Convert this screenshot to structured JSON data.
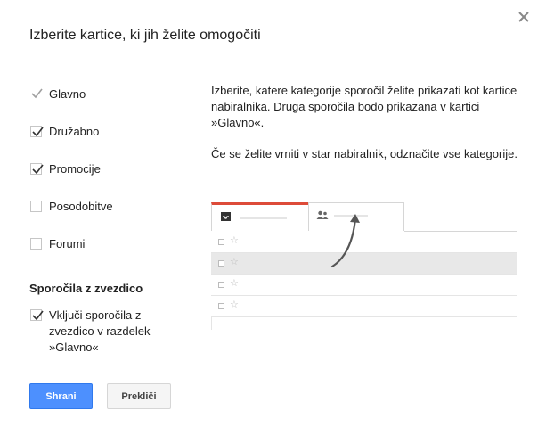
{
  "dialog": {
    "title": "Izberite kartice, ki jih želite omogočiti",
    "close_icon": "close-icon"
  },
  "categories": [
    {
      "label": "Glavno",
      "checked": true,
      "disabled": true
    },
    {
      "label": "Družabno",
      "checked": true,
      "disabled": false
    },
    {
      "label": "Promocije",
      "checked": true,
      "disabled": false
    },
    {
      "label": "Posodobitve",
      "checked": false,
      "disabled": false
    },
    {
      "label": "Forumi",
      "checked": false,
      "disabled": false
    }
  ],
  "starred": {
    "heading": "Sporočila z zvezdico",
    "option_label": "Vključi sporočila z zvezdico v razdelek »Glavno«",
    "checked": true
  },
  "description": {
    "paragraph1": "Izberite, katere kategorije sporočil želite prikazati kot kartice nabiralnika. Druga sporočila bodo prikazana v kartici »Glavno«.",
    "paragraph2": "Če se želite vrniti v star nabiralnik, odznačite vse kategorije."
  },
  "preview": {
    "tabs": [
      {
        "icon": "inbox-icon"
      },
      {
        "icon": "people-icon"
      }
    ],
    "rows": [
      {
        "highlighted": false
      },
      {
        "highlighted": true
      },
      {
        "highlighted": false
      },
      {
        "highlighted": false
      }
    ]
  },
  "buttons": {
    "save_label": "Shrani",
    "cancel_label": "Prekliči"
  },
  "colors": {
    "primary_button": "#4d90fe",
    "primary_tab_accent": "#dd4b39"
  }
}
